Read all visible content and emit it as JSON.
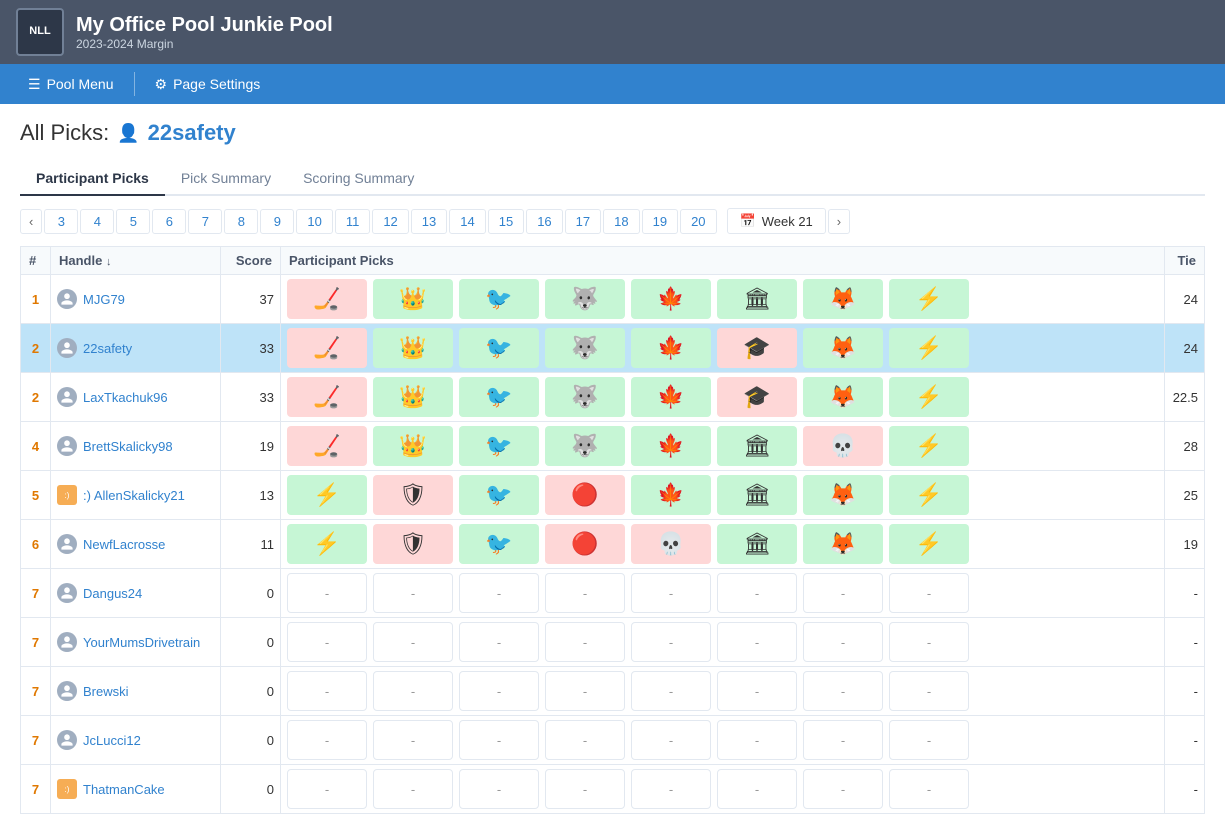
{
  "app": {
    "logo": "NLL",
    "title": "My Office Pool Junkie Pool",
    "subtitle": "2023-2024 Margin"
  },
  "nav": {
    "pool_menu": "Pool Menu",
    "page_settings": "Page Settings"
  },
  "page": {
    "heading_prefix": "All Picks:",
    "username": "22safety",
    "current_week": "Week 21"
  },
  "tabs": [
    {
      "id": "participant-picks",
      "label": "Participant Picks",
      "active": true
    },
    {
      "id": "pick-summary",
      "label": "Pick Summary",
      "active": false
    },
    {
      "id": "scoring-summary",
      "label": "Scoring Summary",
      "active": false
    }
  ],
  "week_numbers": [
    "3",
    "4",
    "5",
    "6",
    "7",
    "8",
    "9",
    "10",
    "11",
    "12",
    "13",
    "14",
    "15",
    "16",
    "17",
    "18",
    "19",
    "20"
  ],
  "table": {
    "headers": [
      "#",
      "Handle",
      "Score",
      "Participant Picks",
      "Tie"
    ],
    "rows": [
      {
        "rank": "1",
        "handle": "MJG79",
        "avatar_type": "user",
        "score": "37",
        "tie": "24",
        "highlighted": false,
        "picks": [
          {
            "color": "pink",
            "logo": "🏒"
          },
          {
            "color": "green",
            "logo": "👑"
          },
          {
            "color": "green",
            "logo": "🐦"
          },
          {
            "color": "green",
            "logo": "🐺"
          },
          {
            "color": "green",
            "logo": "🍁"
          },
          {
            "color": "green",
            "logo": "🏛"
          },
          {
            "color": "green",
            "logo": "🦊"
          },
          {
            "color": "green",
            "logo": "⚡"
          }
        ]
      },
      {
        "rank": "2",
        "handle": "22safety",
        "avatar_type": "user",
        "score": "33",
        "tie": "24",
        "highlighted": true,
        "picks": [
          {
            "color": "pink",
            "logo": "🏒"
          },
          {
            "color": "green",
            "logo": "👑"
          },
          {
            "color": "green",
            "logo": "🐦"
          },
          {
            "color": "green",
            "logo": "🐺"
          },
          {
            "color": "green",
            "logo": "🍁"
          },
          {
            "color": "pink",
            "logo": "🎓"
          },
          {
            "color": "green",
            "logo": "🦊"
          },
          {
            "color": "green",
            "logo": "⚡"
          }
        ]
      },
      {
        "rank": "2",
        "handle": "LaxTkachuk96",
        "avatar_type": "user",
        "score": "33",
        "tie": "22.5",
        "highlighted": false,
        "picks": [
          {
            "color": "pink",
            "logo": "🏒"
          },
          {
            "color": "green",
            "logo": "👑"
          },
          {
            "color": "green",
            "logo": "🐦"
          },
          {
            "color": "green",
            "logo": "🐺"
          },
          {
            "color": "green",
            "logo": "🍁"
          },
          {
            "color": "pink",
            "logo": "🎓"
          },
          {
            "color": "green",
            "logo": "🦊"
          },
          {
            "color": "green",
            "logo": "⚡"
          }
        ]
      },
      {
        "rank": "4",
        "handle": "BrettSkalicky98",
        "avatar_type": "user",
        "score": "19",
        "tie": "28",
        "highlighted": false,
        "picks": [
          {
            "color": "pink",
            "logo": "🏒"
          },
          {
            "color": "green",
            "logo": "👑"
          },
          {
            "color": "green",
            "logo": "🐦"
          },
          {
            "color": "green",
            "logo": "🐺"
          },
          {
            "color": "green",
            "logo": "🍁"
          },
          {
            "color": "green",
            "logo": "🏛"
          },
          {
            "color": "pink",
            "logo": "💀"
          },
          {
            "color": "green",
            "logo": "⚡"
          }
        ]
      },
      {
        "rank": "5",
        "handle": ":) AllenSkalicky21",
        "avatar_type": "special",
        "score": "13",
        "tie": "25",
        "highlighted": false,
        "picks": [
          {
            "color": "green",
            "logo": "⚡"
          },
          {
            "color": "pink",
            "logo": "🛡"
          },
          {
            "color": "green",
            "logo": "🐦"
          },
          {
            "color": "pink",
            "logo": "🔴"
          },
          {
            "color": "green",
            "logo": "🍁"
          },
          {
            "color": "green",
            "logo": "🏛"
          },
          {
            "color": "green",
            "logo": "🦊"
          },
          {
            "color": "green",
            "logo": "⚡"
          }
        ]
      },
      {
        "rank": "6",
        "handle": "NewfLacrosse",
        "avatar_type": "user",
        "score": "11",
        "tie": "19",
        "highlighted": false,
        "picks": [
          {
            "color": "green",
            "logo": "⚡"
          },
          {
            "color": "pink",
            "logo": "🛡"
          },
          {
            "color": "green",
            "logo": "🐦"
          },
          {
            "color": "pink",
            "logo": "🔴"
          },
          {
            "color": "pink",
            "logo": "💀"
          },
          {
            "color": "green",
            "logo": "🏛"
          },
          {
            "color": "green",
            "logo": "🦊"
          },
          {
            "color": "green",
            "logo": "⚡"
          }
        ]
      },
      {
        "rank": "7",
        "handle": "Dangus24",
        "avatar_type": "user",
        "score": "0",
        "tie": "-",
        "highlighted": false,
        "picks": []
      },
      {
        "rank": "7",
        "handle": "YourMumsDrivetrain",
        "avatar_type": "user",
        "score": "0",
        "tie": "-",
        "highlighted": false,
        "picks": []
      },
      {
        "rank": "7",
        "handle": "Brewski",
        "avatar_type": "user",
        "score": "0",
        "tie": "-",
        "highlighted": false,
        "picks": []
      },
      {
        "rank": "7",
        "handle": "JcLucci12",
        "avatar_type": "user",
        "score": "0",
        "tie": "-",
        "highlighted": false,
        "picks": []
      },
      {
        "rank": "7",
        "handle": "ThatmanCake",
        "avatar_type": "special",
        "score": "0",
        "tie": "-",
        "highlighted": false,
        "picks": []
      }
    ]
  },
  "icons": {
    "menu": "☰",
    "gear": "⚙",
    "user": "👤",
    "prev": "‹",
    "next": "›",
    "calendar": "📅"
  }
}
